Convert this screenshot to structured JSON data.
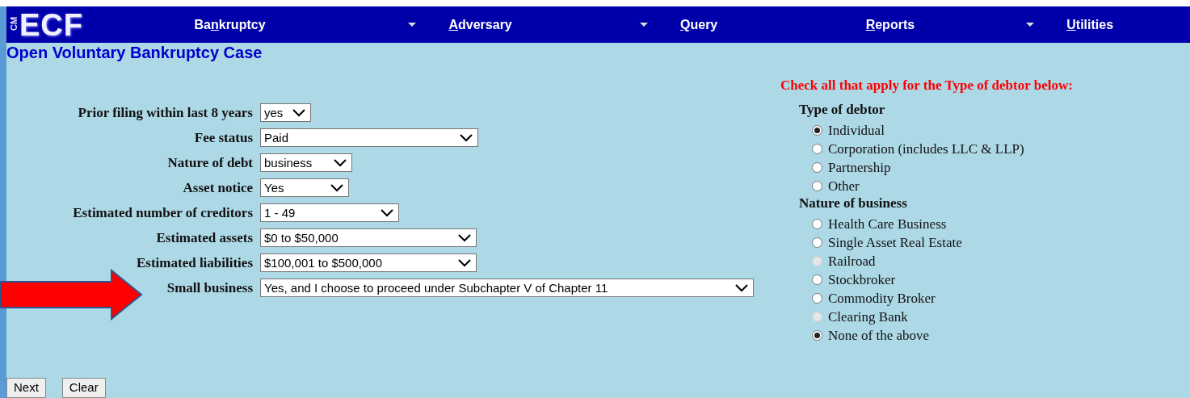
{
  "logo": {
    "small": "CM",
    "large": "ECF"
  },
  "menu": [
    {
      "pre": "Ba",
      "key": "n",
      "post": "kruptcy",
      "dropdown": true
    },
    {
      "key": "A",
      "post": "dversary",
      "dropdown": true
    },
    {
      "key": "Q",
      "post": "uery",
      "dropdown": false
    },
    {
      "key": "R",
      "post": "eports",
      "dropdown": true
    },
    {
      "key": "U",
      "post": "tilities",
      "dropdown": false
    }
  ],
  "page_title": "Open Voluntary Bankruptcy Case",
  "form": [
    {
      "label": "Prior filing within last 8 years",
      "value": "yes"
    },
    {
      "label": "Fee status",
      "value": "Paid"
    },
    {
      "label": "Nature of debt",
      "value": "business"
    },
    {
      "label": "Asset notice",
      "value": "Yes"
    },
    {
      "label": "Estimated number of creditors",
      "value": "1 - 49"
    },
    {
      "label": "Estimated assets",
      "value": "$0 to $50,000"
    },
    {
      "label": "Estimated liabilities",
      "value": "$100,001 to $500,000"
    },
    {
      "label": "Small business",
      "value": "Yes, and I choose to proceed under Subchapter V of Chapter 11"
    }
  ],
  "instruction": "Check all that apply for the Type of debtor below:",
  "groups": [
    {
      "title": "Type of debtor",
      "options": [
        {
          "label": "Individual",
          "selected": true,
          "disabled": false
        },
        {
          "label": "Corporation (includes LLC & LLP)",
          "selected": false,
          "disabled": false
        },
        {
          "label": "Partnership",
          "selected": false,
          "disabled": false
        },
        {
          "label": "Other",
          "selected": false,
          "disabled": false
        }
      ]
    },
    {
      "title": "Nature of business",
      "options": [
        {
          "label": "Health Care Business",
          "selected": false,
          "disabled": false
        },
        {
          "label": "Single Asset Real Estate",
          "selected": false,
          "disabled": false
        },
        {
          "label": "Railroad",
          "selected": false,
          "disabled": true
        },
        {
          "label": "Stockbroker",
          "selected": false,
          "disabled": false
        },
        {
          "label": "Commodity Broker",
          "selected": false,
          "disabled": false
        },
        {
          "label": "Clearing Bank",
          "selected": false,
          "disabled": true
        },
        {
          "label": "None of the above",
          "selected": true,
          "disabled": false
        }
      ]
    }
  ],
  "buttons": [
    "Next",
    "Clear"
  ]
}
